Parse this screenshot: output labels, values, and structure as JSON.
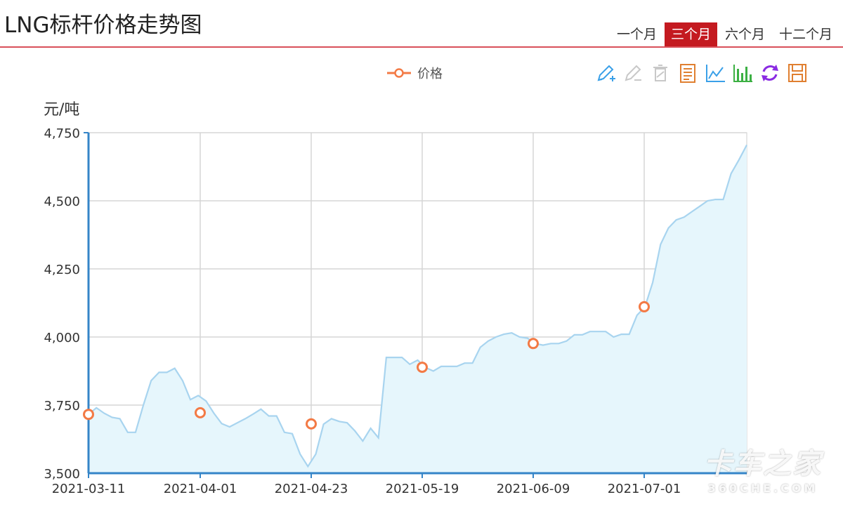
{
  "title": "LNG标杆价格走势图",
  "tabs": [
    {
      "label": "一个月",
      "active": false
    },
    {
      "label": "三个月",
      "active": true
    },
    {
      "label": "六个月",
      "active": false
    },
    {
      "label": "十二个月",
      "active": false
    }
  ],
  "legend": {
    "label": "价格"
  },
  "toolbox": [
    {
      "icon": "pencil-plus-icon",
      "color": "#3aa0e8"
    },
    {
      "icon": "pencil-icon",
      "color": "#c8c8c8"
    },
    {
      "icon": "trash-icon",
      "color": "#c8c8c8"
    },
    {
      "icon": "data-view-icon",
      "color": "#e07f30"
    },
    {
      "icon": "line-chart-icon",
      "color": "#3aa0e8"
    },
    {
      "icon": "bar-chart-icon",
      "color": "#3cb043"
    },
    {
      "icon": "refresh-icon",
      "color": "#8a2be2"
    },
    {
      "icon": "save-icon",
      "color": "#e07f30"
    }
  ],
  "watermark": {
    "main": "卡车之家",
    "sub": "360CHE.COM"
  },
  "colors": {
    "line": "#a8d4ef",
    "area": "#e6f6fc",
    "marker": "#f37a45",
    "axis": "#3585c8",
    "active_tab": "#c41a20"
  },
  "chart_data": {
    "type": "area",
    "ylabel": "元/吨",
    "ylim": [
      3500,
      4750
    ],
    "y_ticks": [
      3500,
      3750,
      4000,
      4250,
      4500,
      4750
    ],
    "y_tick_labels": [
      "3,500",
      "3,750",
      "4,000",
      "4,250",
      "4,500",
      "4,750"
    ],
    "x_tick_labels": [
      "2021-03-11",
      "2021-04-01",
      "2021-04-23",
      "2021-05-19",
      "2021-06-09",
      "2021-07-01"
    ],
    "grid": true,
    "series": [
      {
        "name": "价格",
        "values": [
          3716,
          3740,
          3720,
          3705,
          3700,
          3650,
          3650,
          3750,
          3840,
          3870,
          3870,
          3885,
          3840,
          3770,
          3785,
          3765,
          3720,
          3682,
          3670,
          3685,
          3700,
          3717,
          3735,
          3710,
          3710,
          3650,
          3645,
          3570,
          3525,
          3570,
          3680,
          3700,
          3690,
          3685,
          3655,
          3618,
          3665,
          3630,
          3925,
          3925,
          3925,
          3900,
          3915,
          3888,
          3875,
          3892,
          3892,
          3892,
          3904,
          3904,
          3962,
          3985,
          4000,
          4010,
          4015,
          4000,
          3996,
          3976,
          3970,
          3976,
          3976,
          3985,
          4008,
          4008,
          4020,
          4020,
          4020,
          4000,
          4010,
          4010,
          4080,
          4110,
          4200,
          4340,
          4400,
          4430,
          4440,
          4460,
          4480,
          4500,
          4505,
          4505,
          4600,
          4650,
          4705
        ],
        "markers": [
          {
            "x": "2021-03-11",
            "y": 3716
          },
          {
            "x": "2021-04-01",
            "y": 3722
          },
          {
            "x": "2021-04-23",
            "y": 3681
          },
          {
            "x": "2021-05-19",
            "y": 3889
          },
          {
            "x": "2021-06-09",
            "y": 3976
          },
          {
            "x": "2021-07-01",
            "y": 4111
          }
        ]
      }
    ]
  }
}
